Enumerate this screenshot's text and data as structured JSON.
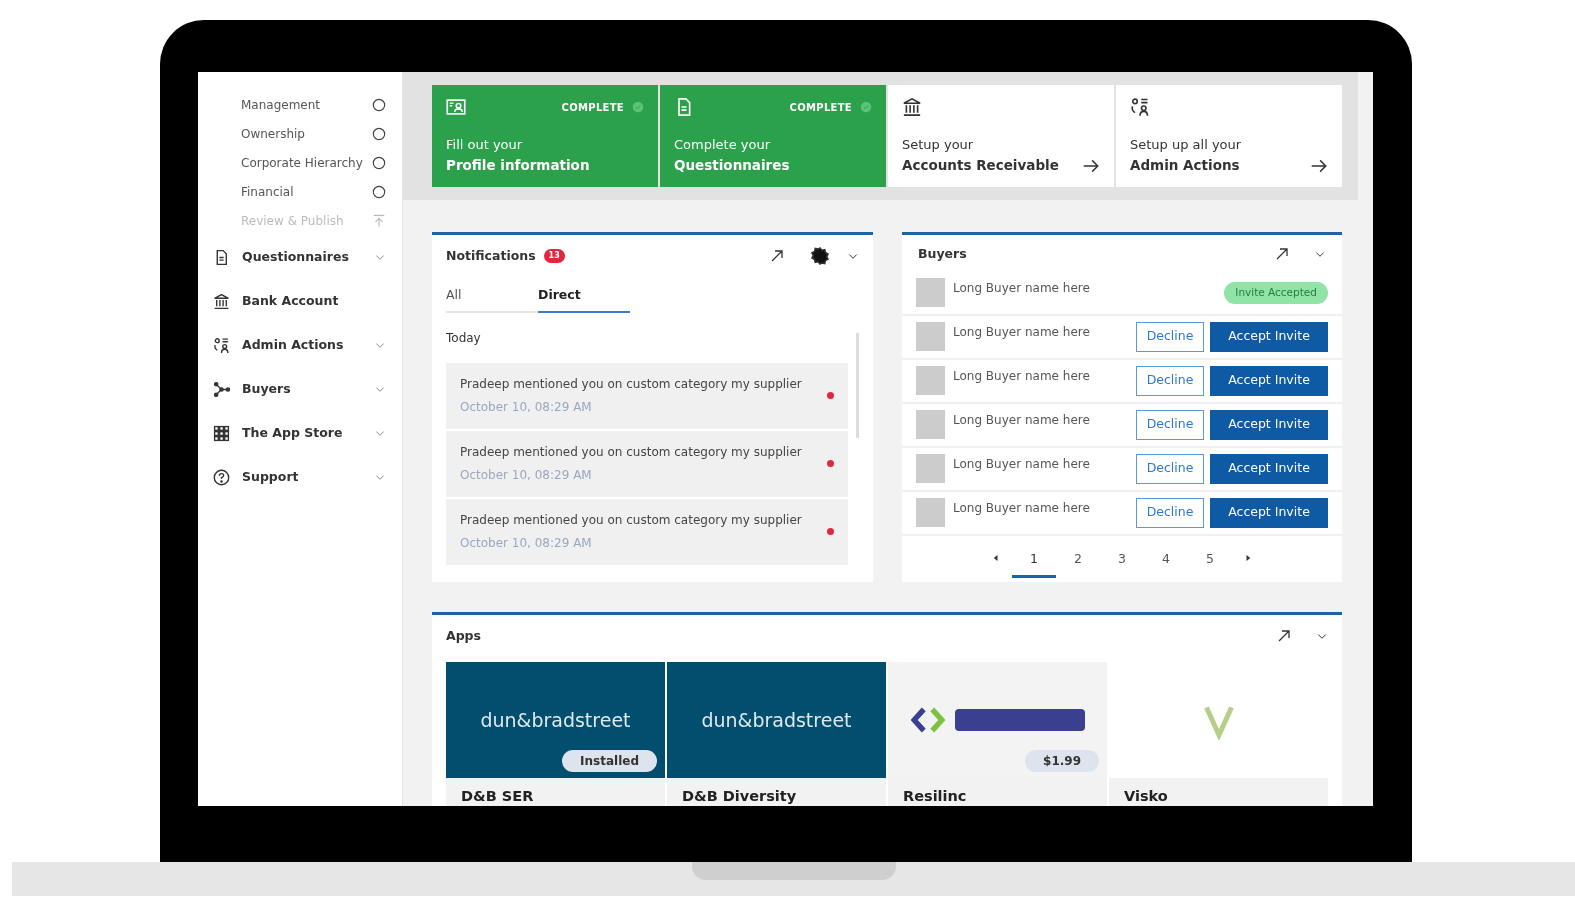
{
  "sidebar": {
    "steps": [
      {
        "label": "Management",
        "kind": "step",
        "disabled": false
      },
      {
        "label": "Ownership",
        "kind": "step",
        "disabled": false
      },
      {
        "label": "Corporate Hierarchy",
        "kind": "step",
        "disabled": false
      },
      {
        "label": "Financial",
        "kind": "step",
        "disabled": false
      },
      {
        "label": "Review & Publish",
        "kind": "publish",
        "disabled": true
      }
    ],
    "nav": [
      {
        "label": "Questionnaires",
        "expandable": true
      },
      {
        "label": "Bank Account",
        "expandable": false
      },
      {
        "label": "Admin Actions",
        "expandable": true
      },
      {
        "label": "Buyers",
        "expandable": true
      },
      {
        "label": "The App Store",
        "expandable": true
      },
      {
        "label": "Support",
        "expandable": true
      }
    ]
  },
  "setup_cards": [
    {
      "complete": true,
      "status": "COMPLETE",
      "line1": "Fill out your",
      "line2": "Profile information"
    },
    {
      "complete": true,
      "status": "COMPLETE",
      "line1": "Complete your",
      "line2": "Questionnaires"
    },
    {
      "complete": false,
      "line1": "Setup your",
      "line2": "Accounts Receivable"
    },
    {
      "complete": false,
      "line1": "Setup up all your",
      "line2": "Admin Actions"
    }
  ],
  "notifications": {
    "title": "Notifications",
    "badge": "13",
    "tabs": [
      {
        "label": "All",
        "selected": false
      },
      {
        "label": "Direct",
        "selected": true
      }
    ],
    "group": "Today",
    "items": [
      {
        "text": "Pradeep mentioned you on custom category my supplier",
        "time": "October 10, 08:29 AM",
        "unread": true
      },
      {
        "text": "Pradeep mentioned you on custom category my supplier",
        "time": "October 10, 08:29 AM",
        "unread": true
      },
      {
        "text": "Pradeep mentioned you on custom category my supplier",
        "time": "October 10, 08:29 AM",
        "unread": true
      }
    ]
  },
  "buyers": {
    "title": "Buyers",
    "rows": [
      {
        "name": "Long Buyer name here",
        "kind": "accepted",
        "status": "Invite Accepted"
      },
      {
        "name": "Long Buyer name here",
        "kind": "pending",
        "decline": "Decline",
        "accept": "Accept Invite"
      },
      {
        "name": "Long Buyer name here",
        "kind": "pending",
        "decline": "Decline",
        "accept": "Accept Invite"
      },
      {
        "name": "Long Buyer name here",
        "kind": "pending",
        "decline": "Decline",
        "accept": "Accept Invite"
      },
      {
        "name": "Long Buyer name here",
        "kind": "pending",
        "decline": "Decline",
        "accept": "Accept Invite"
      },
      {
        "name": "Long Buyer name here",
        "kind": "pending",
        "decline": "Decline",
        "accept": "Accept Invite"
      }
    ],
    "pages": [
      {
        "label": "1",
        "selected": true
      },
      {
        "label": "2",
        "selected": false
      },
      {
        "label": "3",
        "selected": false
      },
      {
        "label": "4",
        "selected": false
      },
      {
        "label": "5",
        "selected": false
      }
    ]
  },
  "apps": {
    "title": "Apps",
    "items": [
      {
        "name": "D&B SER",
        "kind": "dnb",
        "logo": "dun&bradstreet",
        "tag": "Installed"
      },
      {
        "name": "D&B Diversity",
        "kind": "dnb",
        "logo": "dun&bradstreet"
      },
      {
        "name": "Resilinc",
        "kind": "resilinc",
        "tag": "$1.99"
      },
      {
        "name": "Visko",
        "kind": "visko"
      }
    ]
  }
}
